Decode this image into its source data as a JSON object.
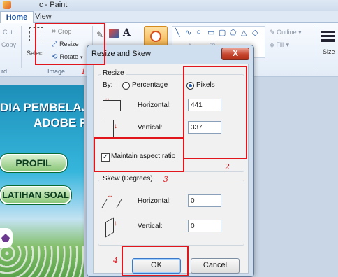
{
  "window": {
    "title": "c - Paint"
  },
  "tabs": {
    "home": "Home",
    "view": "View"
  },
  "ribbon": {
    "clipboard": {
      "cut": "Cut",
      "copy": "Copy",
      "group": "rd"
    },
    "image": {
      "select": "Select",
      "crop": "Crop",
      "resize": "Resize",
      "rotate": "Rotate",
      "group": "Image"
    },
    "shapes": {
      "outline": "Outline",
      "fill": "Fill"
    },
    "size": {
      "label": "Size"
    }
  },
  "canvas_text": {
    "line1": "DIA PEMBELAJA",
    "line2": "ADOBE F",
    "profil": "PROFIL",
    "latihan": "LATIHAN SOAL"
  },
  "dialog": {
    "title": "Resize and Skew",
    "close": "X",
    "resize": {
      "group": "Resize",
      "by": "By:",
      "percentage": "Percentage",
      "pixels": "Pixels",
      "horizontal": "Horizontal:",
      "horizontal_value": "441",
      "vertical": "Vertical:",
      "vertical_value": "337",
      "maintain": "Maintain aspect ratio"
    },
    "skew": {
      "group": "Skew (Degrees)",
      "horizontal": "Horizontal:",
      "horizontal_value": "0",
      "vertical": "Vertical:",
      "vertical_value": "0"
    },
    "ok": "OK",
    "cancel": "Cancel"
  },
  "annotations": {
    "n1": "1",
    "n2": "2",
    "n3": "3",
    "n4": "4"
  },
  "colors": {
    "annotation": "#e0161c",
    "accent": "#2a5da8"
  }
}
